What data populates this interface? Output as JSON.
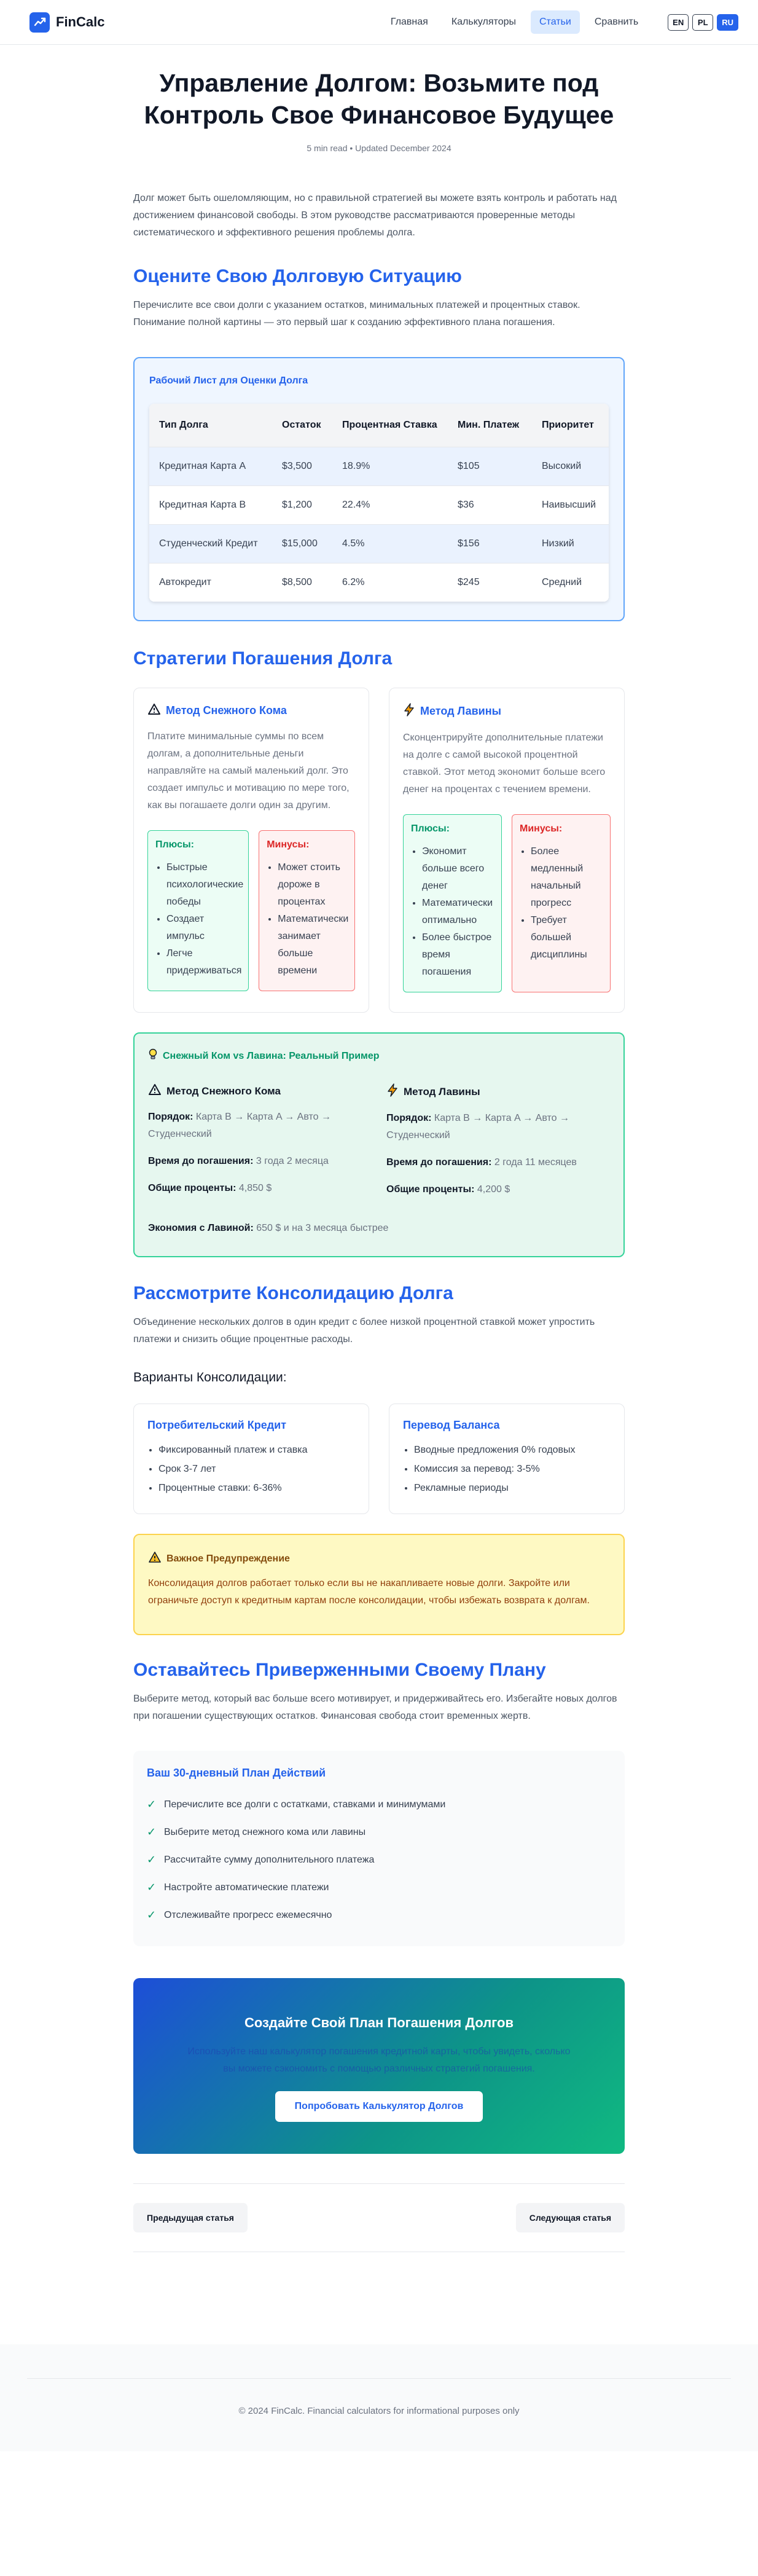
{
  "header": {
    "brand": "FinCalc",
    "nav": [
      "Главная",
      "Калькуляторы",
      "Статьи",
      "Сравнить"
    ],
    "active_nav": "Статьи",
    "languages": [
      "EN",
      "PL",
      "RU"
    ],
    "active_language": "RU"
  },
  "article": {
    "title_line1": "Управление Долгом: Возьмите под",
    "title_line2": "Контроль Свое Финансовое Будущее",
    "meta": "5 min read • Updated December 2024",
    "intro": "Долг может быть ошеломляющим, но с правильной стратегией вы можете взять контроль и работать над достижением финансовой свободы. В этом руководстве рассматриваются проверенные методы систематического и эффективного решения проблемы долга."
  },
  "assess": {
    "title": "Оцените Свою Долговую Ситуацию",
    "text": "Перечислите все свои долги с указанием остатков, минимальных платежей и процентных ставок. Понимание полной картины — это первый шаг к созданию эффективного плана погашения.",
    "worksheet_title": "Рабочий Лист для Оценки Долга",
    "columns": [
      "Тип Долга",
      "Остаток",
      "Процентная Ставка",
      "Мин. Платеж",
      "Приоритет"
    ],
    "rows": [
      [
        "Кредитная Карта A",
        "$3,500",
        "18.9%",
        "$105",
        "Высокий"
      ],
      [
        "Кредитная Карта B",
        "$1,200",
        "22.4%",
        "$36",
        "Наивысший"
      ],
      [
        "Студенческий Кредит",
        "$15,000",
        "4.5%",
        "$156",
        "Низкий"
      ],
      [
        "Автокредит",
        "$8,500",
        "6.2%",
        "$245",
        "Средний"
      ]
    ]
  },
  "strategies": {
    "title": "Стратегии Погашения Долга",
    "snowball": {
      "title": "Метод Снежного Кома",
      "text": "Платите минимальные суммы по всем долгам, а дополнительные деньги направляйте на самый маленький долг. Это создает импульс и мотивацию по мере того, как вы погашаете долги один за другим.",
      "pros_title": "Плюсы:",
      "pros": [
        "Быстрые психологические победы",
        "Создает импульс",
        "Легче придерживаться"
      ],
      "cons_title": "Минусы:",
      "cons": [
        "Может стоить дороже в процентах",
        "Математически занимает больше времени"
      ]
    },
    "avalanche": {
      "title": "Метод Лавины",
      "text": "Сконцентрируйте дополнительные платежи на долге с самой высокой процентной ставкой. Этот метод экономит больше всего денег на процентах с течением времени.",
      "pros_title": "Плюсы:",
      "pros": [
        "Экономит больше всего денег",
        "Математически оптимально",
        "Более быстрое время погашения"
      ],
      "cons_title": "Минусы:",
      "cons": [
        "Более медленный начальный прогресс",
        "Требует большей дисциплины"
      ]
    }
  },
  "example": {
    "title": "Снежный Ком vs Лавина: Реальный Пример",
    "snowball": {
      "title": "Метод Снежного Кома",
      "order_label": "Порядок:",
      "order": "Карта B → Карта A → Авто → Студенческий",
      "time_label": "Время до погашения:",
      "time": "3 года 2 месяца",
      "interest_label": "Общие проценты:",
      "interest": "4,850 $"
    },
    "avalanche": {
      "title": "Метод Лавины",
      "order_label": "Порядок:",
      "order": "Карта B → Карта A → Авто → Студенческий",
      "time_label": "Время до погашения:",
      "time": "2 года 11 месяцев",
      "interest_label": "Общие проценты:",
      "interest": "4,200 $"
    },
    "summary_label": "Экономия с Лавиной:",
    "summary": "650 $ и на 3 месяца быстрее"
  },
  "consolidation": {
    "title": "Рассмотрите Консолидацию Долга",
    "text": "Объединение нескольких долгов в один кредит с более низкой процентной ставкой может упростить платежи и снизить общие процентные расходы.",
    "variants_title": "Варианты Консолидации:",
    "personal_loan": {
      "title": "Потребительский Кредит",
      "items": [
        "Фиксированный платеж и ставка",
        "Срок 3-7 лет",
        "Процентные ставки: 6-36%"
      ]
    },
    "balance_transfer": {
      "title": "Перевод Баланса",
      "items": [
        "Вводные предложения 0% годовых",
        "Комиссия за перевод: 3-5%",
        "Рекламные периоды"
      ]
    },
    "warning_title": "Важное Предупреждение",
    "warning_text": "Консолидация долгов работает только если вы не накапливаете новые долги. Закройте или ограничьте доступ к кредитным картам после консолидации, чтобы избежать возврата к долгам."
  },
  "commit": {
    "title": "Оставайтесь Приверженными Своему Плану",
    "text": "Выберите метод, который вас больше всего мотивирует, и придерживайтесь его. Избегайте новых долгов при погашении существующих остатков. Финансовая свобода стоит временных жертв.",
    "plan_title": "Ваш 30-дневный План Действий",
    "plan_items": [
      "Перечислите все долги с остатками, ставками и минимумами",
      "Выберите метод снежного кома или лавины",
      "Рассчитайте сумму дополнительного платежа",
      "Настройте автоматические платежи",
      "Отслеживайте прогресс ежемесячно"
    ]
  },
  "cta": {
    "title": "Создайте Свой План Погашения Долгов",
    "text": "Используйте наш калькулятор погашения кредитной карты, чтобы увидеть, сколько вы можете сэкономить с помощью различных стратегий погашения.",
    "button": "Попробовать Калькулятор Долгов"
  },
  "article_nav": {
    "prev": "Предыдущая статья",
    "next": "Следующая статья"
  },
  "footer": {
    "text": "© 2024 FinCalc. Financial calculators for informational purposes only"
  }
}
